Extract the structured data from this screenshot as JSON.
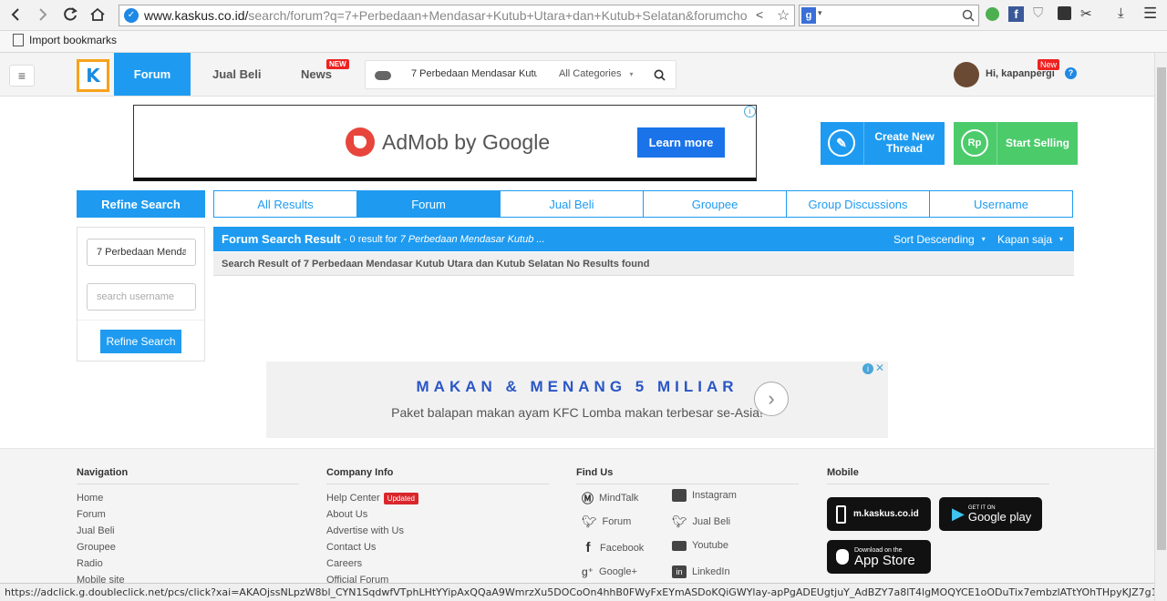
{
  "browser": {
    "url_host": "www.kaskus.co.id/",
    "url_path": "search/forum?q=7+Perbedaan+Mendasar+Kutub+Utara+dan+Kutub+Selatan&forumcho",
    "bookmark_label": "Import bookmarks",
    "status_url": "https://adclick.g.doubleclick.net/pcs/click?xai=AKAOjssNLpzW8bl_CYN1SqdwfVTphLHtYYipAxQQaA9WmrzXu5DOCoOn4hhB0FWyFxEYmASDoKQiGWYlay-apPgADEUgtjuY_AdBZY7a8lT4lgMOQYCE1oODuTix7embzlATtYOhTHpyKJZ7g1iWbcvZJLbaks0..."
  },
  "header": {
    "logo": "K",
    "nav": [
      "Forum",
      "Jual Beli",
      "News"
    ],
    "new_badge": "NEW",
    "search_value": "7 Perbedaan Mendasar Kutub",
    "category": "All Categories",
    "greeting": "Hi, kapanpergi",
    "user_badge": "New"
  },
  "ad_top": {
    "brand": "AdMob by Google",
    "cta": "Learn more"
  },
  "actions": {
    "create": "Create New Thread",
    "sell": "Start Selling"
  },
  "refine": {
    "title": "Refine Search",
    "query_value": "7 Perbedaan Mendasar Kutub",
    "username_placeholder": "search username",
    "button": "Refine Search"
  },
  "tabs": [
    {
      "label": "All Results",
      "active": false
    },
    {
      "label": "Forum",
      "active": true
    },
    {
      "label": "Jual Beli",
      "active": false
    },
    {
      "label": "Groupee",
      "active": false
    },
    {
      "label": "Group Discussions",
      "active": false
    },
    {
      "label": "Username",
      "active": false
    }
  ],
  "results": {
    "title": "Forum Search Result",
    "count_text": " - 0 result for ",
    "query_short": "7 Perbedaan Mendasar Kutub ...",
    "sort": "Sort Descending",
    "time": "Kapan saja",
    "message": "Search Result of 7 Perbedaan Mendasar Kutub Utara dan Kutub Selatan No Results found"
  },
  "ad_mid": {
    "headline": "MAKAN & MENANG 5 MILIAR",
    "sub": "Paket balapan makan ayam KFC Lomba makan terbesar se-Asia!"
  },
  "footer": {
    "navigation": {
      "title": "Navigation",
      "links": [
        "Home",
        "Forum",
        "Jual Beli",
        "Groupee",
        "Radio",
        "Mobile site"
      ]
    },
    "company": {
      "title": "Company Info",
      "links": [
        "Help Center",
        "About Us",
        "Advertise with Us",
        "Contact Us",
        "Careers",
        "Official Forum"
      ],
      "updated_badge": "Updated"
    },
    "find": {
      "title": "Find Us",
      "left": [
        "MindTalk",
        "Forum",
        "Facebook",
        "Google+"
      ],
      "right": [
        "Instagram",
        "Jual Beli",
        "Youtube",
        "LinkedIn"
      ]
    },
    "mobile": {
      "title": "Mobile",
      "mobile_site": "m.kaskus.co.id",
      "gplay_small": "GET IT ON",
      "gplay": "Google play",
      "appstore_small": "Download on the",
      "appstore": "App Store"
    }
  }
}
